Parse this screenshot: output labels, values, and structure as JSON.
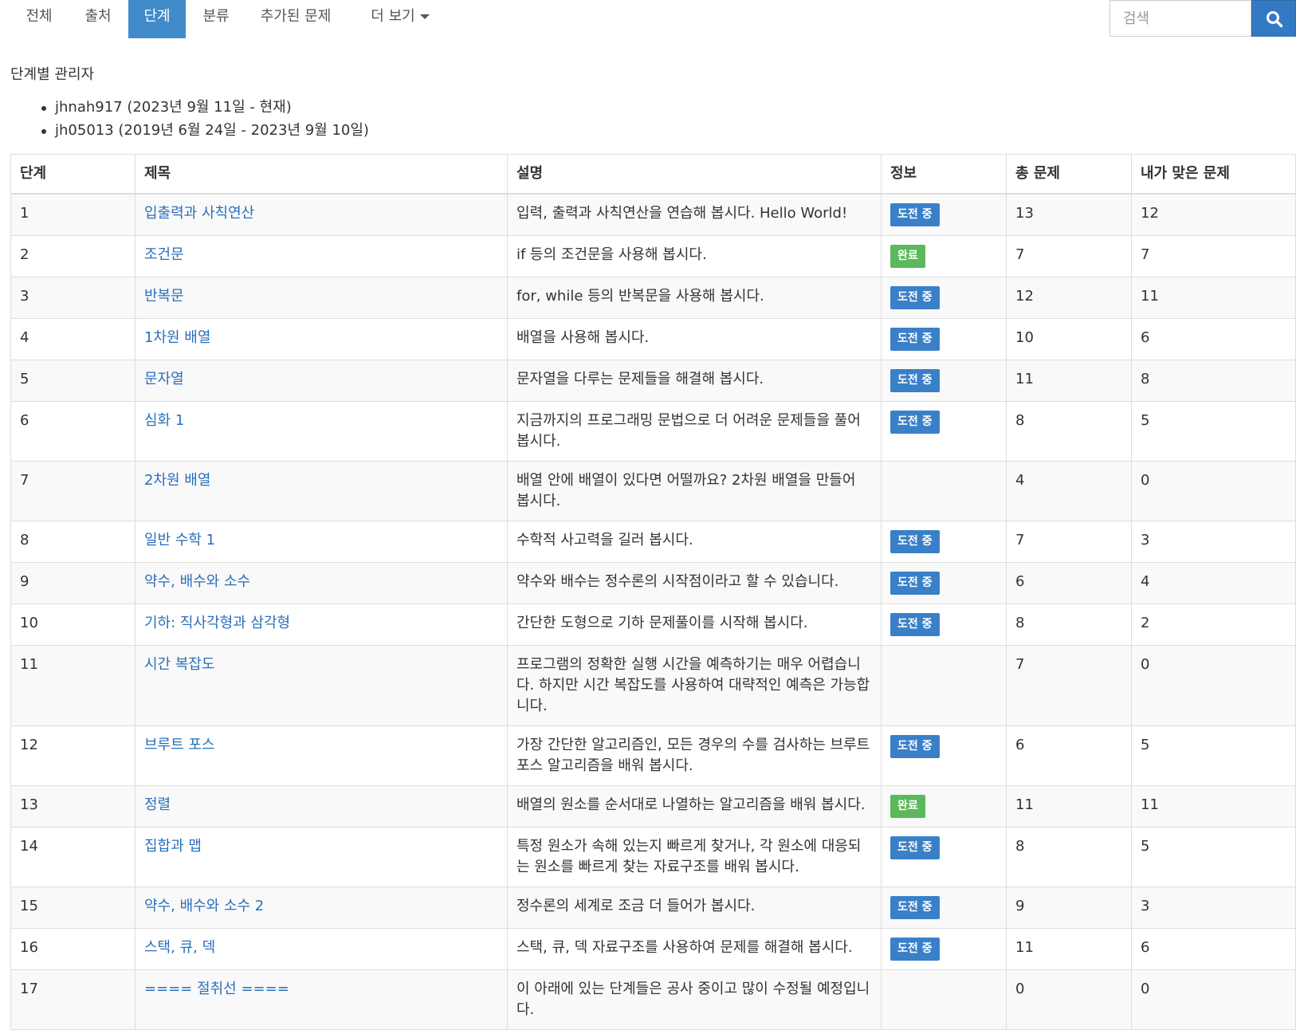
{
  "nav": {
    "tabs": [
      {
        "label": "전체",
        "active": false
      },
      {
        "label": "출처",
        "active": false
      },
      {
        "label": "단계",
        "active": true
      },
      {
        "label": "분류",
        "active": false
      },
      {
        "label": "추가된 문제",
        "active": false
      },
      {
        "label": "더 보기",
        "active": false,
        "has_dropdown": true
      }
    ]
  },
  "search": {
    "placeholder": "검색",
    "value": "",
    "button_icon": "search-icon"
  },
  "managers": {
    "title": "단계별 관리자",
    "items": [
      "jhnah917 (2023년 9월 11일 - 현재)",
      "jh05013 (2019년 6월 24일 - 2023년 9월 10일)"
    ]
  },
  "table": {
    "headers": [
      "단계",
      "제목",
      "설명",
      "정보",
      "총 문제",
      "내가 맞은 문제"
    ],
    "rows": [
      {
        "step": "1",
        "title": "입출력과 사칙연산",
        "desc": "입력, 출력과 사칙연산을 연습해 봅시다. Hello World!",
        "status": "도전 중",
        "total": "13",
        "solved": "12"
      },
      {
        "step": "2",
        "title": "조건문",
        "desc": "if 등의 조건문을 사용해 봅시다.",
        "status": "완료",
        "total": "7",
        "solved": "7"
      },
      {
        "step": "3",
        "title": "반복문",
        "desc": "for, while 등의 반복문을 사용해 봅시다.",
        "status": "도전 중",
        "total": "12",
        "solved": "11"
      },
      {
        "step": "4",
        "title": "1차원 배열",
        "desc": "배열을 사용해 봅시다.",
        "status": "도전 중",
        "total": "10",
        "solved": "6"
      },
      {
        "step": "5",
        "title": "문자열",
        "desc": "문자열을 다루는 문제들을 해결해 봅시다.",
        "status": "도전 중",
        "total": "11",
        "solved": "8"
      },
      {
        "step": "6",
        "title": "심화 1",
        "desc": "지금까지의 프로그래밍 문법으로 더 어려운 문제들을 풀어봅시다.",
        "status": "도전 중",
        "total": "8",
        "solved": "5"
      },
      {
        "step": "7",
        "title": "2차원 배열",
        "desc": "배열 안에 배열이 있다면 어떨까요? 2차원 배열을 만들어 봅시다.",
        "status": "",
        "total": "4",
        "solved": "0"
      },
      {
        "step": "8",
        "title": "일반 수학 1",
        "desc": "수학적 사고력을 길러 봅시다.",
        "status": "도전 중",
        "total": "7",
        "solved": "3"
      },
      {
        "step": "9",
        "title": "약수, 배수와 소수",
        "desc": "약수와 배수는 정수론의 시작점이라고 할 수 있습니다.",
        "status": "도전 중",
        "total": "6",
        "solved": "4"
      },
      {
        "step": "10",
        "title": "기하: 직사각형과 삼각형",
        "desc": "간단한 도형으로 기하 문제풀이를 시작해 봅시다.",
        "status": "도전 중",
        "total": "8",
        "solved": "2"
      },
      {
        "step": "11",
        "title": "시간 복잡도",
        "desc": "프로그램의 정확한 실행 시간을 예측하기는 매우 어렵습니다. 하지만 시간 복잡도를 사용하여 대략적인 예측은 가능합니다.",
        "status": "",
        "total": "7",
        "solved": "0"
      },
      {
        "step": "12",
        "title": "브루트 포스",
        "desc": "가장 간단한 알고리즘인, 모든 경우의 수를 검사하는 브루트 포스 알고리즘을 배워 봅시다.",
        "status": "도전 중",
        "total": "6",
        "solved": "5"
      },
      {
        "step": "13",
        "title": "정렬",
        "desc": "배열의 원소를 순서대로 나열하는 알고리즘을 배워 봅시다.",
        "status": "완료",
        "total": "11",
        "solved": "11"
      },
      {
        "step": "14",
        "title": "집합과 맵",
        "desc": "특정 원소가 속해 있는지 빠르게 찾거나, 각 원소에 대응되는 원소를 빠르게 찾는 자료구조를 배워 봅시다.",
        "status": "도전 중",
        "total": "8",
        "solved": "5"
      },
      {
        "step": "15",
        "title": "약수, 배수와 소수 2",
        "desc": "정수론의 세계로 조금 더 들어가 봅시다.",
        "status": "도전 중",
        "total": "9",
        "solved": "3"
      },
      {
        "step": "16",
        "title": "스택, 큐, 덱",
        "desc": "스택, 큐, 덱 자료구조를 사용하여 문제를 해결해 봅시다.",
        "status": "도전 중",
        "total": "11",
        "solved": "6"
      },
      {
        "step": "17",
        "title": "==== 절취선 ====",
        "desc": "이 아래에 있는 단계들은 공사 중이고 많이 수정될 예정입니다.",
        "status": "",
        "total": "0",
        "solved": "0"
      }
    ]
  },
  "colors": {
    "accent": "#428bca",
    "link": "#2a6fba",
    "badge_in_progress": "#3a80c8",
    "badge_done": "#5cb85c"
  }
}
